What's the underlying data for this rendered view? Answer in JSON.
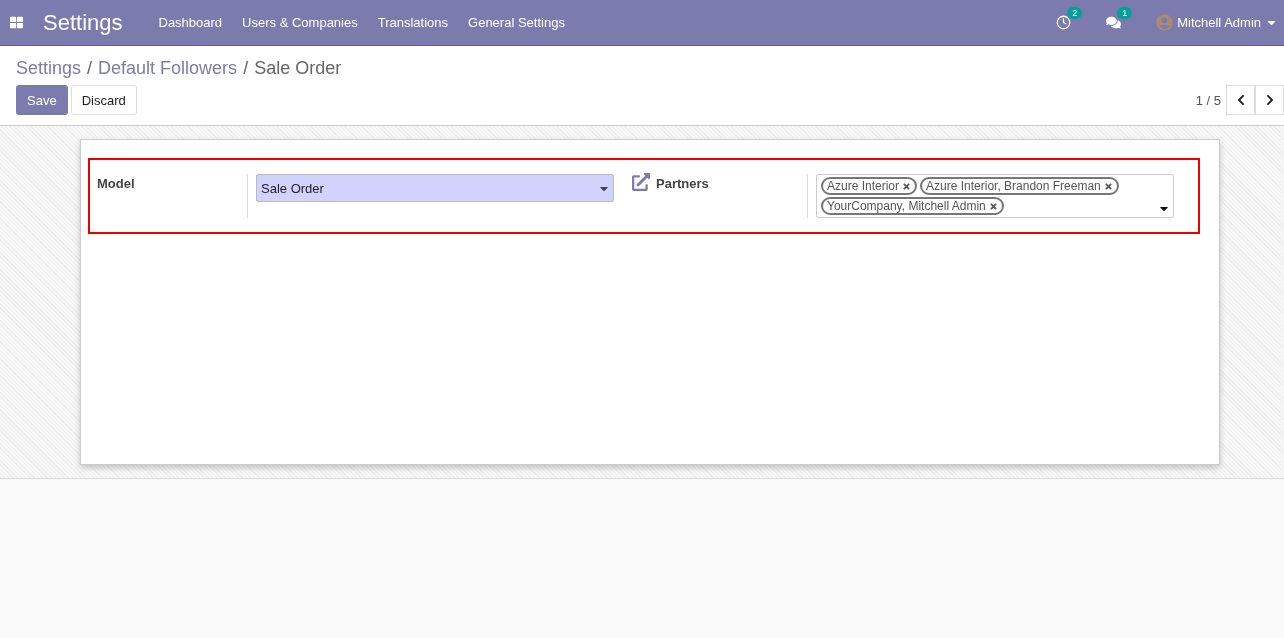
{
  "navbar": {
    "app_title": "Settings",
    "menu": [
      "Dashboard",
      "Users & Companies",
      "Translations",
      "General Settings"
    ],
    "activity_count": "2",
    "message_count": "1",
    "user": "Mitchell Admin"
  },
  "breadcrumb_separator": "/",
  "breadcrumb": [
    {
      "label": "Settings",
      "link": true
    },
    {
      "label": "Default Followers",
      "link": true
    },
    {
      "label": "Sale Order",
      "link": false
    }
  ],
  "buttons": [
    {
      "label": "Save",
      "primary": true
    },
    {
      "label": "Discard",
      "primary": false
    }
  ],
  "pager": "1 / 5",
  "form": {
    "model_label": "Model",
    "model_value": "Sale Order",
    "partners_label": "Partners",
    "partners": [
      "Azure Interior",
      "Azure Interior, Brandon Freeman",
      "YourCompany, Mitchell Admin"
    ]
  }
}
